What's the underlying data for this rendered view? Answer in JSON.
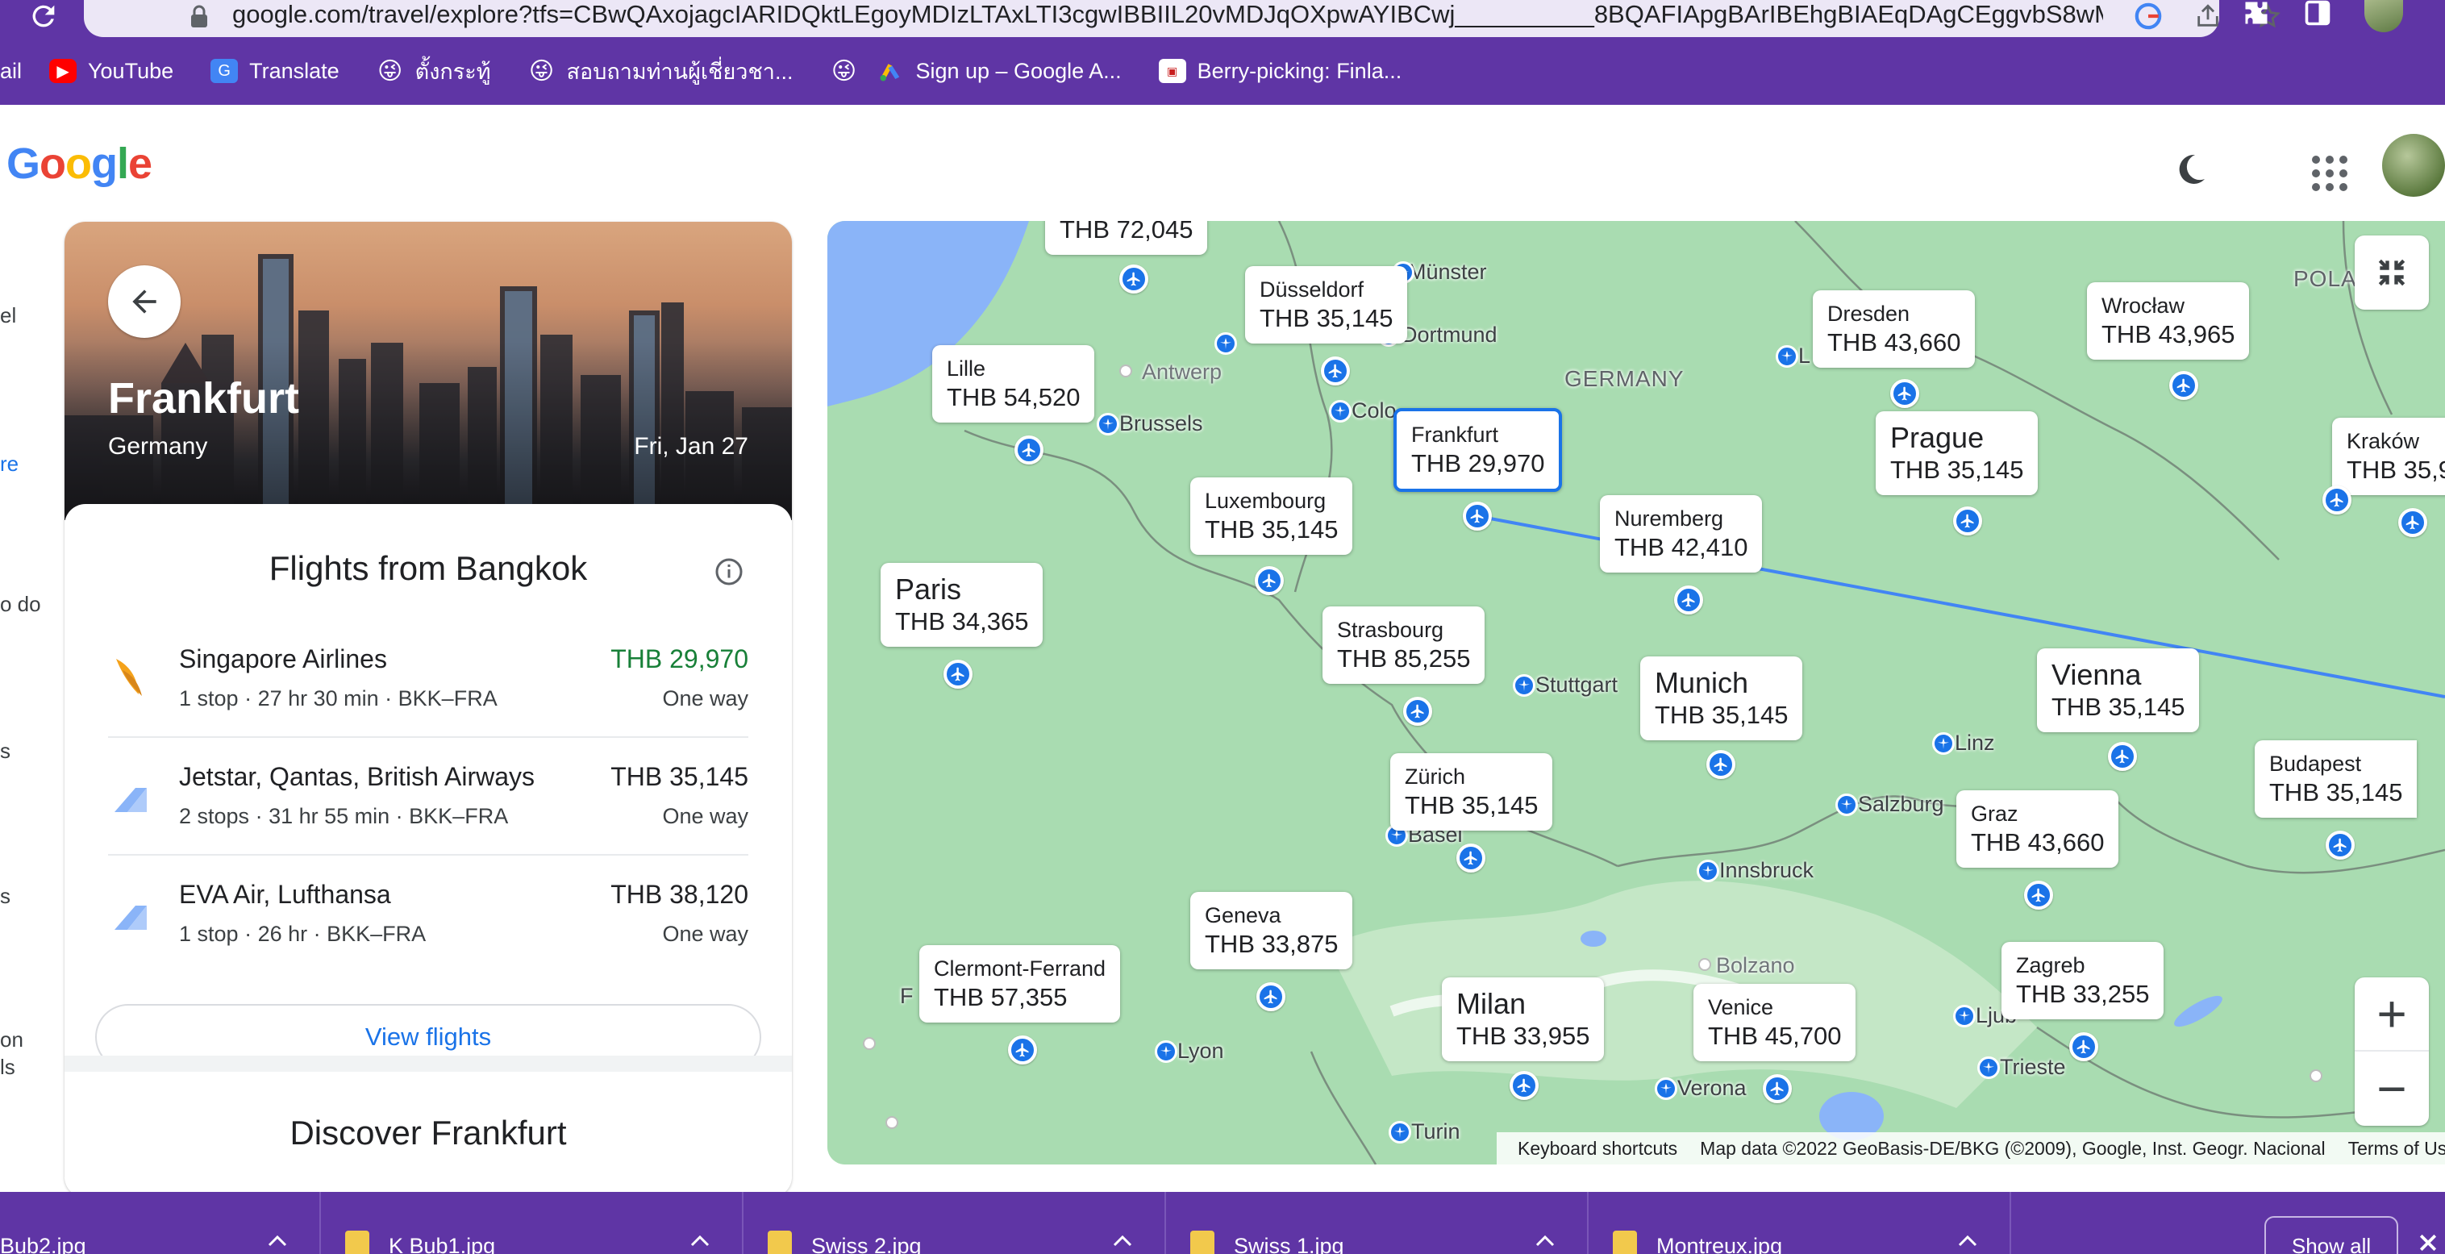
{
  "browser": {
    "url": "google.com/travel/explore?tfs=CBwQAxojagcIARIDQktLEgoyMDIzLTAxLTI3cgwIBBIIL20vMDJqOXpwAYIBCwj__________8BQAFIApgBArIBEhgBIAEqDAgCEggvbS8wMnow...",
    "bookmarks": [
      {
        "label": "ail",
        "icon": "none"
      },
      {
        "label": "YouTube",
        "icon": "youtube-icon"
      },
      {
        "label": "Translate",
        "icon": "translate-icon"
      },
      {
        "label": "ตั้งกระทู้",
        "icon": "emoji-icon"
      },
      {
        "label": "สอบถามท่านผู้เชี่ยวชา...",
        "icon": "emoji-icon"
      },
      {
        "label": "",
        "icon": "emoji-icon"
      },
      {
        "label": "Sign up – Google A...",
        "icon": "google-ads-icon"
      },
      {
        "label": "Berry-picking: Finla...",
        "icon": "berry-icon"
      }
    ]
  },
  "header": {
    "logo": "Google"
  },
  "leftnav": [
    "el",
    "re",
    "o do",
    "s",
    "s",
    "on",
    "ls"
  ],
  "destination": {
    "city": "Frankfurt",
    "country": "Germany",
    "date": "Fri, Jan 27",
    "flights_title": "Flights from Bangkok",
    "flights": [
      {
        "airline": "Singapore Airlines",
        "stops": "1 stop",
        "duration": "27 hr 30 min",
        "route": "BKK–FRA",
        "price": "THB 29,970",
        "trip": "One way",
        "best": true
      },
      {
        "airline": "Jetstar, Qantas, British Airways",
        "stops": "2 stops",
        "duration": "31 hr 55 min",
        "route": "BKK–FRA",
        "price": "THB 35,145",
        "trip": "One way",
        "best": false
      },
      {
        "airline": "EVA Air, Lufthansa",
        "stops": "1 stop",
        "duration": "26 hr",
        "route": "BKK–FRA",
        "price": "THB 38,120",
        "trip": "One way",
        "best": false
      }
    ],
    "view_flights": "View flights",
    "discover": "Discover Frankfurt"
  },
  "map": {
    "price_cards": [
      {
        "city": "",
        "price": "THB 72,045"
      },
      {
        "city": "Düsseldorf",
        "price": "THB 35,145"
      },
      {
        "city": "Lille",
        "price": "THB 54,520"
      },
      {
        "city": "Dresden",
        "price": "THB 43,660"
      },
      {
        "city": "Wrocław",
        "price": "THB 43,965"
      },
      {
        "city": "Kraków",
        "price": "THB 35,9"
      },
      {
        "city": "Frankfurt",
        "price": "THB 29,970"
      },
      {
        "city": "Prague",
        "price": "THB 35,145"
      },
      {
        "city": "Luxembourg",
        "price": "THB 35,145"
      },
      {
        "city": "Nuremberg",
        "price": "THB 42,410"
      },
      {
        "city": "Paris",
        "price": "THB 34,365"
      },
      {
        "city": "Strasbourg",
        "price": "THB 85,255"
      },
      {
        "city": "Munich",
        "price": "THB 35,145"
      },
      {
        "city": "Vienna",
        "price": "THB 35,145"
      },
      {
        "city": "Budapest",
        "price": "THB 35,145"
      },
      {
        "city": "Zürich",
        "price": "THB 35,145"
      },
      {
        "city": "Graz",
        "price": "THB 43,660"
      },
      {
        "city": "Geneva",
        "price": "THB 33,875"
      },
      {
        "city": "Clermont-Ferrand",
        "price": "THB 57,355"
      },
      {
        "city": "Milan",
        "price": "THB 33,955"
      },
      {
        "city": "Venice",
        "price": "THB 45,700"
      },
      {
        "city": "Zagreb",
        "price": "THB 33,255"
      }
    ],
    "place_labels": [
      "Münster",
      "Dortmund",
      "Antwerp",
      "Brussels",
      "Colo",
      "GERMANY",
      "L",
      "POLA",
      "Stuttgart",
      "Linz",
      "Salzburg",
      "Basel",
      "Innsbruck",
      "Bolzano",
      "Lyon",
      "Verona",
      "Trieste",
      "Ljub",
      "Turin",
      "F"
    ],
    "attribution": {
      "shortcuts": "Keyboard shortcuts",
      "data": "Map data ©2022 GeoBasis-DE/BKG (©2009), Google, Inst. Geogr. Nacional",
      "terms": "Terms of Use"
    },
    "zoom_in": "+",
    "zoom_out": "−"
  },
  "downloads": {
    "items": [
      "Bub2.jpg",
      "K Bub1.jpg",
      "Swiss 2.jpg",
      "Swiss 1.jpg",
      "Montreux.jpg"
    ],
    "show_all": "Show all"
  },
  "colors": {
    "chrome": "#5f35a5",
    "map_land": "#a9dcb1",
    "accent": "#1a73e8",
    "best_price": "#188038"
  }
}
